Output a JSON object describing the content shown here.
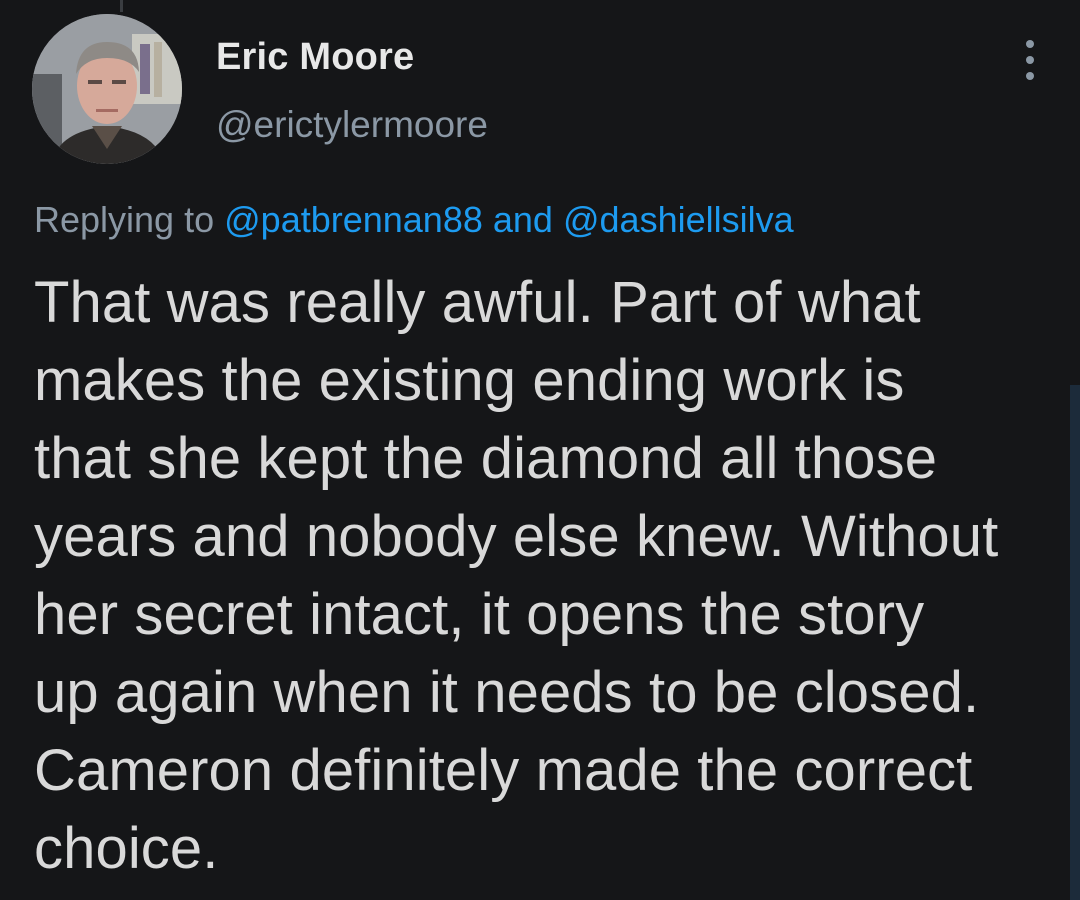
{
  "tweet": {
    "author": {
      "display_name": "Eric Moore",
      "handle": "@erictylermoore"
    },
    "replying": {
      "prefix": "Replying to",
      "mentions": [
        "@patbrennan88",
        "@dashiellsilva"
      ],
      "conjunction": "and"
    },
    "text_lines": [
      "That was really awful. Part of what",
      "makes the existing ending work is",
      "that she kept the diamond all those",
      "years and nobody else knew. Without",
      "her secret intact, it opens the story",
      "up again when it needs to be closed.",
      "Cameron definitely made the correct",
      "choice."
    ]
  },
  "icons": {
    "more": "more-vertical-icon"
  },
  "colors": {
    "background": "#151618",
    "text": "#d9d9d9",
    "muted": "#8b98a5",
    "link": "#1d9bf0"
  }
}
